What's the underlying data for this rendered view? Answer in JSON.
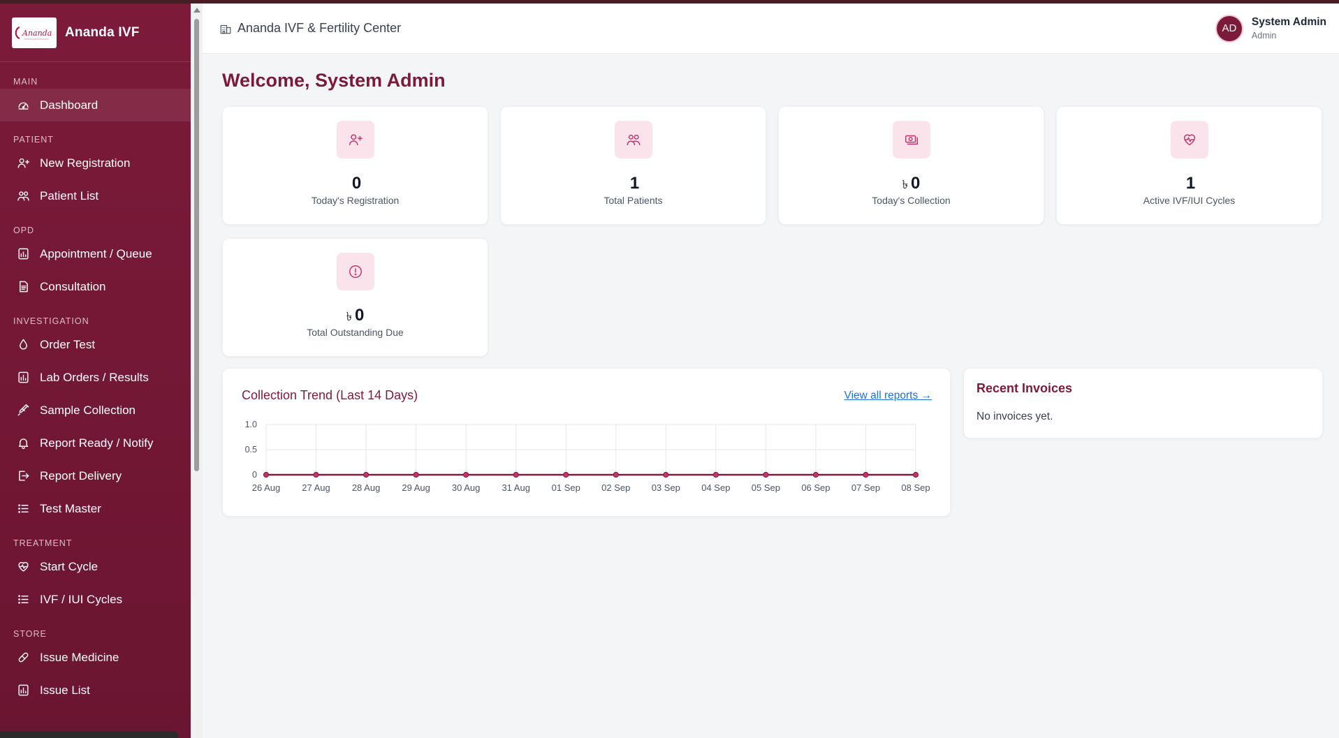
{
  "app": {
    "brand_name": "Ananda IVF",
    "logo_text": "Ananda",
    "center_name": "Ananda IVF & Fertility Center"
  },
  "user": {
    "initials": "AD",
    "name": "System Admin",
    "role": "Admin"
  },
  "sidebar": {
    "sections": [
      {
        "label": "MAIN",
        "items": [
          {
            "label": "Dashboard",
            "icon": "gauge-icon",
            "active": true
          }
        ]
      },
      {
        "label": "PATIENT",
        "items": [
          {
            "label": "New Registration",
            "icon": "user-plus-icon"
          },
          {
            "label": "Patient List",
            "icon": "users-icon"
          }
        ]
      },
      {
        "label": "OPD",
        "items": [
          {
            "label": "Appointment / Queue",
            "icon": "calendar-doc-icon"
          },
          {
            "label": "Consultation",
            "icon": "document-icon"
          }
        ]
      },
      {
        "label": "INVESTIGATION",
        "items": [
          {
            "label": "Order Test",
            "icon": "droplet-icon"
          },
          {
            "label": "Lab Orders / Results",
            "icon": "chart-doc-icon"
          },
          {
            "label": "Sample Collection",
            "icon": "syringe-icon"
          },
          {
            "label": "Report Ready / Notify",
            "icon": "bell-icon"
          },
          {
            "label": "Report Delivery",
            "icon": "export-icon"
          },
          {
            "label": "Test Master",
            "icon": "list-icon"
          }
        ]
      },
      {
        "label": "TREATMENT",
        "items": [
          {
            "label": "Start Cycle",
            "icon": "heart-pulse-icon"
          },
          {
            "label": "IVF / IUI Cycles",
            "icon": "list-icon"
          }
        ]
      },
      {
        "label": "STORE",
        "items": [
          {
            "label": "Issue Medicine",
            "icon": "pill-icon"
          },
          {
            "label": "Issue List",
            "icon": "chart-doc-icon"
          }
        ]
      }
    ]
  },
  "main": {
    "welcome": "Welcome, System Admin",
    "stats": [
      {
        "value": "0",
        "currency": "",
        "label": "Today's Registration",
        "icon": "user-plus-icon"
      },
      {
        "value": "1",
        "currency": "",
        "label": "Total Patients",
        "icon": "users-icon"
      },
      {
        "value": "0",
        "currency": "৳",
        "label": "Today's Collection",
        "icon": "money-icon"
      },
      {
        "value": "1",
        "currency": "",
        "label": "Active IVF/IUI Cycles",
        "icon": "heart-pulse-icon"
      },
      {
        "value": "0",
        "currency": "৳",
        "label": "Total Outstanding Due",
        "icon": "alert-circle-icon"
      }
    ],
    "trend": {
      "title": "Collection Trend (Last 14 Days)",
      "link": "View all reports →"
    },
    "invoices": {
      "title": "Recent Invoices",
      "empty_text": "No invoices yet."
    }
  },
  "colors": {
    "brand": "#7c1a3a",
    "accent_pink": "#c8326b",
    "icon_bg": "#fbe3ec",
    "link": "#1d6fd8"
  },
  "chart_data": {
    "type": "line",
    "title": "Collection Trend (Last 14 Days)",
    "categories": [
      "26 Aug",
      "27 Aug",
      "28 Aug",
      "29 Aug",
      "30 Aug",
      "31 Aug",
      "01 Sep",
      "02 Sep",
      "03 Sep",
      "04 Sep",
      "05 Sep",
      "06 Sep",
      "07 Sep",
      "08 Sep"
    ],
    "series": [
      {
        "values": [
          0,
          0,
          0,
          0,
          0,
          0,
          0,
          0,
          0,
          0,
          0,
          0,
          0,
          0
        ]
      }
    ],
    "ylim": [
      0,
      1.0
    ],
    "yticks": [
      "1.0",
      "0.5",
      "0"
    ],
    "grid": true,
    "colors": {
      "line": "#7c1a3a",
      "point": "#c8326b"
    }
  }
}
